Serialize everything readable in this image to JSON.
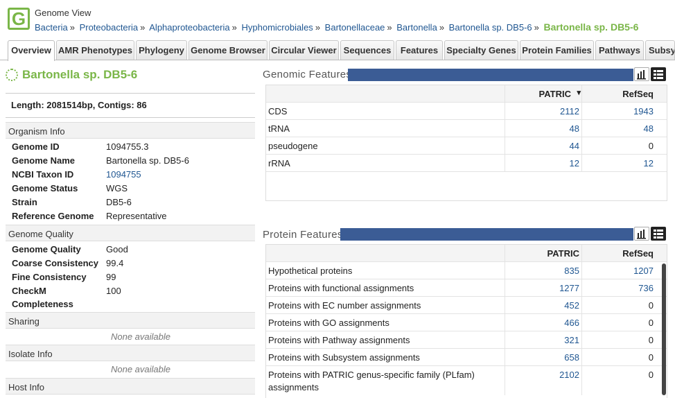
{
  "header": {
    "view_title": "Genome View",
    "logo_letter": "G",
    "breadcrumb": [
      "Bacteria",
      "Proteobacteria",
      "Alphaproteobacteria",
      "Hyphomicrobiales",
      "Bartonellaceae",
      "Bartonella",
      "Bartonella sp. DB5-6"
    ],
    "breadcrumb_sep": "»",
    "breadcrumb_current": "Bartonella sp. DB5-6"
  },
  "tabs": [
    {
      "label": "Overview",
      "active": true
    },
    {
      "label": "AMR Phenotypes"
    },
    {
      "label": "Phylogeny"
    },
    {
      "label": "Genome Browser"
    },
    {
      "label": "Circular Viewer"
    },
    {
      "label": "Sequences"
    },
    {
      "label": "Features"
    },
    {
      "label": "Specialty Genes"
    },
    {
      "label": "Protein Families"
    },
    {
      "label": "Pathways"
    },
    {
      "label": "Subsy"
    }
  ],
  "organism": {
    "name": "Bartonella sp. DB5-6",
    "length_line": "Length: 2081514bp, Contigs: 86"
  },
  "sections": {
    "organism_info": "Organism Info",
    "genome_quality": "Genome Quality",
    "sharing": "Sharing",
    "isolate_info": "Isolate Info",
    "host_info": "Host Info",
    "none_available": "None available"
  },
  "organism_info": [
    {
      "k": "Genome ID",
      "v": "1094755.3"
    },
    {
      "k": "Genome Name",
      "v": "Bartonella sp. DB5-6"
    },
    {
      "k": "NCBI Taxon ID",
      "v": "1094755",
      "link": true
    },
    {
      "k": "Genome Status",
      "v": "WGS"
    },
    {
      "k": "Strain",
      "v": "DB5-6"
    },
    {
      "k": "Reference Genome",
      "v": "Representative"
    }
  ],
  "genome_quality": [
    {
      "k": "Genome Quality",
      "v": "Good"
    },
    {
      "k": "Coarse Consistency",
      "v": "99.4"
    },
    {
      "k": "Fine Consistency",
      "v": "99"
    },
    {
      "k": "CheckM",
      "v": "100"
    },
    {
      "k": "Completeness",
      "v": ""
    }
  ],
  "genomic_features": {
    "title": "Genomic Features",
    "columns": [
      "",
      "PATRIC",
      "RefSeq"
    ],
    "sort_glyph": "▾",
    "rows": [
      {
        "name": "CDS",
        "patric": "2112",
        "refseq": "1943",
        "patric_link": true,
        "refseq_link": true
      },
      {
        "name": "tRNA",
        "patric": "48",
        "refseq": "48",
        "patric_link": true,
        "refseq_link": true
      },
      {
        "name": "pseudogene",
        "patric": "44",
        "refseq": "0",
        "patric_link": true,
        "refseq_link": false
      },
      {
        "name": "rRNA",
        "patric": "12",
        "refseq": "12",
        "patric_link": true,
        "refseq_link": true
      }
    ]
  },
  "protein_features": {
    "title": "Protein Features",
    "columns": [
      "",
      "PATRIC",
      "RefSeq"
    ],
    "rows": [
      {
        "name": "Hypothetical proteins",
        "patric": "835",
        "refseq": "1207",
        "refseq_link": true
      },
      {
        "name": "Proteins with functional assignments",
        "patric": "1277",
        "refseq": "736",
        "refseq_link": true
      },
      {
        "name": "Proteins with EC number assignments",
        "patric": "452",
        "refseq": "0",
        "refseq_link": false
      },
      {
        "name": "Proteins with GO assignments",
        "patric": "466",
        "refseq": "0",
        "refseq_link": false
      },
      {
        "name": "Proteins with Pathway assignments",
        "patric": "321",
        "refseq": "0",
        "refseq_link": false
      },
      {
        "name": "Proteins with Subsystem assignments",
        "patric": "658",
        "refseq": "0",
        "refseq_link": false
      },
      {
        "name": "Proteins with PATRIC genus-specific family (PLfam)",
        "name2": "assignments",
        "patric": "2102",
        "refseq": "0",
        "refseq_link": false
      }
    ]
  },
  "colors": {
    "brand_green": "#7ab648",
    "link_blue": "#1f5691",
    "panel_bar": "#3b5c95"
  },
  "icons": [
    "bar-chart-icon",
    "grid-view-icon",
    "organism-icon"
  ]
}
